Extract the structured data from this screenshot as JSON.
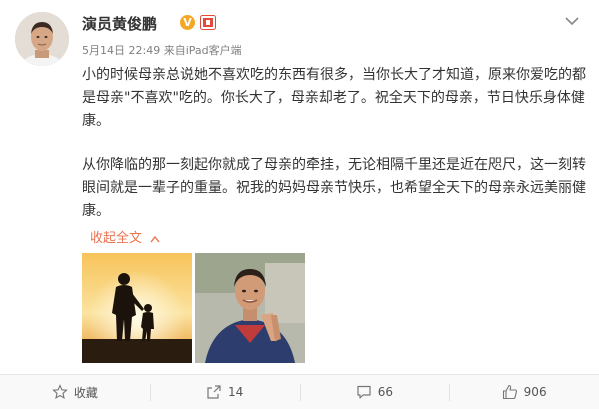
{
  "post": {
    "author": "演员黄俊鹏",
    "verified_mark": "V",
    "time": "5月14日 22:49",
    "source_prefix": "来自",
    "source": "iPad客户端",
    "paragraphs": [
      "小的时候母亲总说她不喜欢吃的东西有很多，当你长大了才知道，原来你爱吃的都是母亲\"不喜欢\"吃的。你长大了，母亲却老了。祝全天下的母亲，节日快乐身体健康。",
      "从你降临的那一刻起你就成了母亲的牵挂，无论相隔千里还是近在咫尺，这一刻转眼间就是一辈子的重量。祝我的妈妈母亲节快乐，也希望全天下的母亲永远美丽健康。"
    ],
    "collapse_label": "收起全文",
    "images": [
      "mother-child-sunset-icon",
      "man-praying-photo-icon"
    ]
  },
  "actions": {
    "favorite": "收藏",
    "repost": "14",
    "comment": "66",
    "like": "906"
  },
  "colors": {
    "link": "#eb7350",
    "meta": "#808080",
    "verified": "#f5a623"
  }
}
